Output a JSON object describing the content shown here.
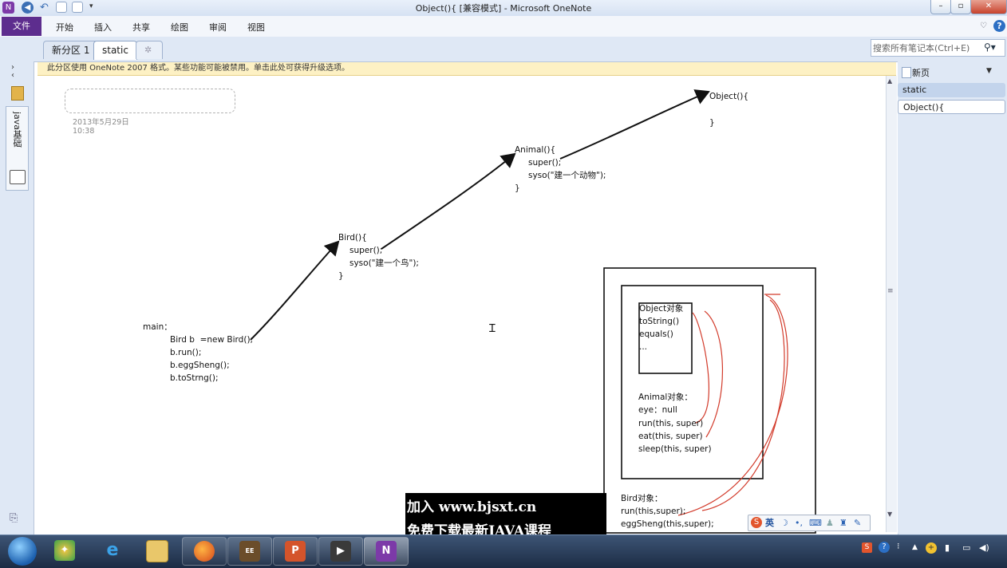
{
  "window": {
    "title": "Object(){ [兼容模式] - Microsoft OneNote"
  },
  "ribbon": {
    "file": "文件",
    "tabs": [
      "开始",
      "插入",
      "共享",
      "绘图",
      "审阅",
      "视图"
    ]
  },
  "sections": {
    "tabs": [
      "新分区 1",
      "static"
    ],
    "new_tab_icon": "sparkle-icon"
  },
  "search": {
    "placeholder": "搜索所有笔记本(Ctrl+E)"
  },
  "notebook": {
    "label": "java基础"
  },
  "infobar": {
    "text": "此分区使用 OneNote 2007 格式。某些功能可能被禁用。单击此处可获得升级选项。"
  },
  "note": {
    "date": "2013年5月29日",
    "time": "10:38"
  },
  "canvas": {
    "main": [
      "main：",
      "Bird b  =new Bird();",
      "b.run();",
      "b.eggSheng();",
      "b.toStrng();"
    ],
    "bird": [
      "Bird(){",
      "super();",
      "syso(\"建一个鸟\");",
      "}"
    ],
    "animal": [
      "Animal(){",
      "super();",
      "syso(\"建一个动物\");",
      "}"
    ],
    "object": [
      "Object(){",
      "}"
    ],
    "object_box": [
      "Object对象",
      "toString()",
      "equals()",
      "..."
    ],
    "animal_box": [
      "Animal对象：",
      "eye：null",
      "run(this, super)",
      "eat(this, super)",
      "sleep(this, super)"
    ],
    "bird_box": [
      "Bird对象：",
      "run(this,super);",
      "eggSheng(this,super);"
    ]
  },
  "pages_panel": {
    "new_page": "新页",
    "items": [
      "static",
      "Object(){"
    ]
  },
  "watermark": {
    "line1": "加入 www.bjsxt.cn",
    "line2": "免费下载最新JAVA课程"
  },
  "ime": {
    "lang": "英"
  },
  "taskbar": {
    "apps": [
      "windows-start-icon",
      "pinwheel-app-icon",
      "ie-icon",
      "explorer-folder-icon",
      "firefox-icon",
      "javaee-ide-icon",
      "powerpoint-icon",
      "media-tool-icon",
      "onenote-icon"
    ]
  },
  "colors": {
    "file_tab": "#5d2d8e",
    "infobar": "#fdf1c4",
    "selected_page": "#c3d4ec",
    "arrow": "#111111",
    "red_ink": "#d23a2a"
  }
}
